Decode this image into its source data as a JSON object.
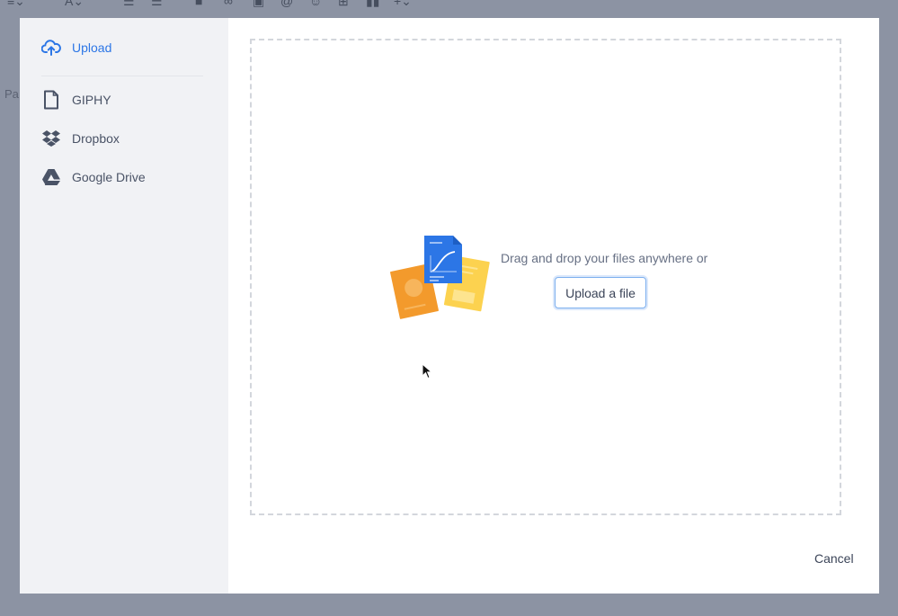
{
  "sidebar": {
    "items": [
      {
        "label": "Upload",
        "icon": "cloud-upload-icon",
        "active": true
      },
      {
        "label": "GIPHY",
        "icon": "file-icon"
      },
      {
        "label": "Dropbox",
        "icon": "dropbox-icon"
      },
      {
        "label": "Google Drive",
        "icon": "google-drive-icon"
      }
    ]
  },
  "dropzone": {
    "instruction": "Drag and drop your files anywhere or",
    "upload_button": "Upload a file"
  },
  "footer": {
    "cancel_label": "Cancel"
  },
  "background": {
    "side_text": "Pa"
  },
  "colors": {
    "accent": "#2c76e6",
    "overlay": "#8c93a3",
    "sidebar_bg": "#f1f2f5"
  }
}
